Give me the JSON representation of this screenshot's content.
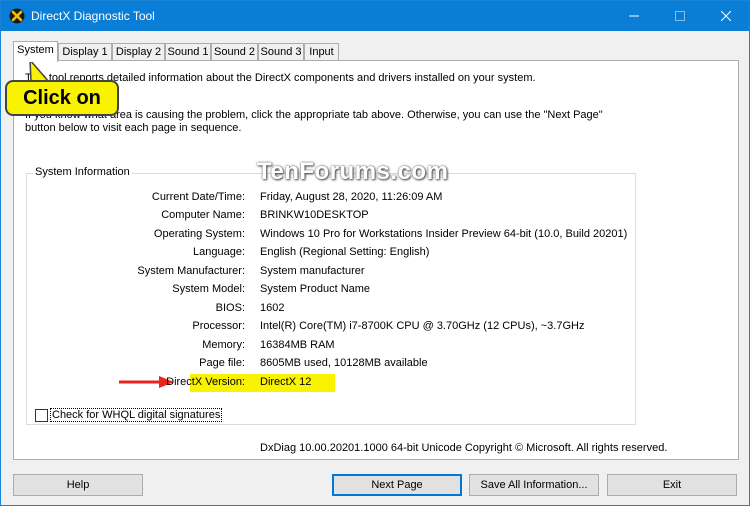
{
  "window": {
    "title": "DirectX Diagnostic Tool",
    "titlebar_color": "#0a7dd6"
  },
  "tabs": [
    {
      "label": "System",
      "active": true
    },
    {
      "label": "Display 1"
    },
    {
      "label": "Display 2"
    },
    {
      "label": "Sound 1"
    },
    {
      "label": "Sound 2"
    },
    {
      "label": "Sound 3"
    },
    {
      "label": "Input"
    }
  ],
  "panel": {
    "intro1": "This tool reports detailed information about the DirectX components and drivers installed on your system.",
    "intro2": "If you know what area is causing the problem, click the appropriate tab above.  Otherwise, you can use the \"Next Page\" button below to visit each page in sequence.",
    "group_label": "System Information",
    "rows": [
      {
        "label": "Current Date/Time:",
        "value": "Friday, August 28, 2020, 11:26:09 AM"
      },
      {
        "label": "Computer Name:",
        "value": "BRINKW10DESKTOP"
      },
      {
        "label": "Operating System:",
        "value": "Windows 10 Pro for Workstations Insider Preview 64-bit (10.0, Build 20201)"
      },
      {
        "label": "Language:",
        "value": "English (Regional Setting: English)"
      },
      {
        "label": "System Manufacturer:",
        "value": "System manufacturer"
      },
      {
        "label": "System Model:",
        "value": "System Product Name"
      },
      {
        "label": "BIOS:",
        "value": "1602"
      },
      {
        "label": "Processor:",
        "value": "Intel(R) Core(TM) i7-8700K CPU @ 3.70GHz (12 CPUs), ~3.7GHz"
      },
      {
        "label": "Memory:",
        "value": "16384MB RAM"
      },
      {
        "label": "Page file:",
        "value": "8605MB used, 10128MB available"
      },
      {
        "label": "DirectX Version:",
        "value": "DirectX 12",
        "highlight": true
      }
    ],
    "whql_label": "Check for WHQL digital signatures",
    "whql_checked": false,
    "footer_info": "DxDiag 10.00.20201.1000 64-bit Unicode  Copyright © Microsoft. All rights reserved."
  },
  "buttons": {
    "help": "Help",
    "next_page": "Next Page",
    "save_all": "Save All Information...",
    "exit": "Exit"
  },
  "annotations": {
    "callout": "Click on",
    "watermark": "TenForums.com",
    "highlight_color": "#f9f200",
    "arrow_color": "#e8251c"
  }
}
